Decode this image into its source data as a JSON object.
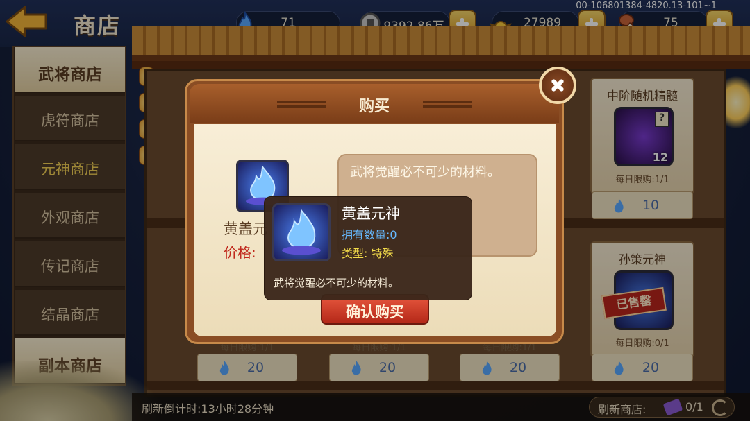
{
  "header": {
    "title": "商店",
    "debug_id": "00-106801384-4820.13-101~1",
    "resources": [
      {
        "icon": "spirit-flame-icon",
        "value": "71"
      },
      {
        "icon": "coin-icon",
        "value": "9392.86万"
      },
      {
        "icon": "gold-ingot-icon",
        "value": "27989"
      },
      {
        "icon": "meat-leg-icon",
        "value": "75"
      }
    ]
  },
  "tabs": [
    {
      "label": "武将商店",
      "state": "active"
    },
    {
      "label": "虎符商店",
      "state": "normal"
    },
    {
      "label": "元神商店",
      "state": "selected"
    },
    {
      "label": "外观商店",
      "state": "normal"
    },
    {
      "label": "传记商店",
      "state": "normal"
    },
    {
      "label": "结晶商店",
      "state": "normal"
    },
    {
      "label": "副本商店",
      "state": "active"
    }
  ],
  "shop_cards": [
    {
      "name": "中阶随机精髓",
      "quantity": "12",
      "limit": "每日限购:1/1",
      "price": "10"
    },
    {
      "name": "孙策元神",
      "limit": "每日限购:0/1",
      "price": "20",
      "stamp": "已售罄"
    }
  ],
  "bottom_row_prices": [
    {
      "limit": "每日限购:1/1",
      "price": "20"
    },
    {
      "limit": "每日限购:1/1",
      "price": "20"
    },
    {
      "limit": "每日限购:1/1",
      "price": "20"
    }
  ],
  "footer": {
    "refresh_timer": "刷新倒计时:13小时28分钟",
    "refresh_label": "刷新商店:",
    "refresh_count": "0/1"
  },
  "dialog": {
    "title": "购买",
    "item_name_partial": "黄盖元",
    "price_label": "价格:",
    "description": "武将觉醒必不可少的材料。",
    "confirm_label": "确认购买"
  },
  "tooltip": {
    "name": "黄盖元神",
    "owned": "拥有数量:0",
    "type": "类型: 特殊",
    "description": "武将觉醒必不可少的材料。"
  },
  "colors": {
    "accent_gold": "#f4d255",
    "owned_blue": "#66b9ff",
    "type_yellow": "#f3dc4a",
    "price_red": "#c0281c",
    "confirm_red": "#d2402a"
  }
}
